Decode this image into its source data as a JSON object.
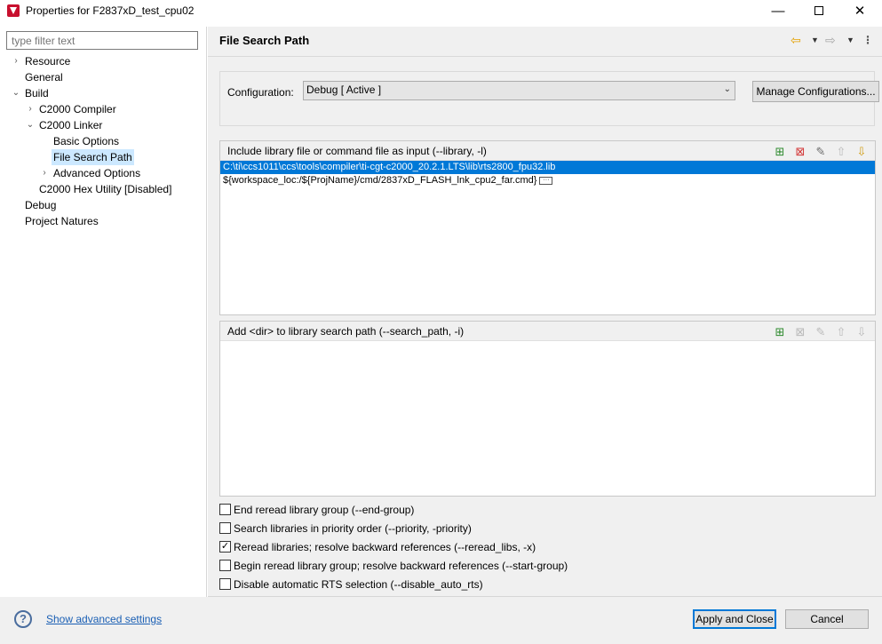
{
  "window": {
    "title": "Properties for F2837xD_test_cpu02",
    "minimize": "—",
    "close": "✕"
  },
  "filter": {
    "placeholder": "type filter text"
  },
  "tree": [
    {
      "label": "Resource",
      "expand": "›"
    },
    {
      "label": "General",
      "expand": ""
    },
    {
      "label": "Build",
      "expand": "⌄"
    },
    {
      "label": "C2000 Compiler",
      "expand": "›"
    },
    {
      "label": "C2000 Linker",
      "expand": "⌄"
    },
    {
      "label": "Basic Options",
      "expand": ""
    },
    {
      "label": "File Search Path",
      "expand": "",
      "selected": true
    },
    {
      "label": "Advanced Options",
      "expand": "›"
    },
    {
      "label": "C2000 Hex Utility  [Disabled]",
      "expand": ""
    },
    {
      "label": "Debug",
      "expand": ""
    },
    {
      "label": "Project Natures",
      "expand": ""
    }
  ],
  "page": {
    "title": "File Search Path",
    "nav": {
      "back_icon": "⇦",
      "forward_icon": "⇨",
      "dropdown": "▼",
      "menu_icon": "⋮"
    }
  },
  "config": {
    "label": "Configuration:",
    "value": "Debug  [ Active ]",
    "chevron": "⌄",
    "manage_label": "Manage Configurations..."
  },
  "include_list": {
    "header": "Include library file or command file as input (--library, -l)",
    "items": [
      "C:\\ti\\ccs1011\\ccs\\tools\\compiler\\ti-cgt-c2000_20.2.1.LTS\\lib\\rts2800_fpu32.lib",
      "${workspace_loc:/${ProjName}/cmd/2837xD_FLASH_lnk_cpu2_far.cmd}"
    ],
    "more_glyph": "···"
  },
  "search_path_list": {
    "header": "Add <dir> to library search path (--search_path, -i)",
    "items": []
  },
  "tool_icons": {
    "add": "⊞",
    "delete": "⊠",
    "edit": "✎",
    "up": "⇧",
    "down": "⇩"
  },
  "checkboxes": [
    {
      "label": "End reread library group (--end-group)",
      "checked": false
    },
    {
      "label": "Search libraries in priority order (--priority, -priority)",
      "checked": false
    },
    {
      "label": "Reread libraries; resolve backward references (--reread_libs, -x)",
      "checked": true
    },
    {
      "label": "Begin reread library group; resolve backward references (--start-group)",
      "checked": false
    },
    {
      "label": "Disable automatic RTS selection (--disable_auto_rts)",
      "checked": false
    }
  ],
  "footer": {
    "help_icon": "?",
    "advanced_link": "Show advanced settings",
    "apply_label": "Apply and Close",
    "cancel_label": "Cancel"
  },
  "colors": {
    "selection": "#0078d7",
    "tree_selection": "#cce8ff",
    "link": "#1a5fb4"
  }
}
